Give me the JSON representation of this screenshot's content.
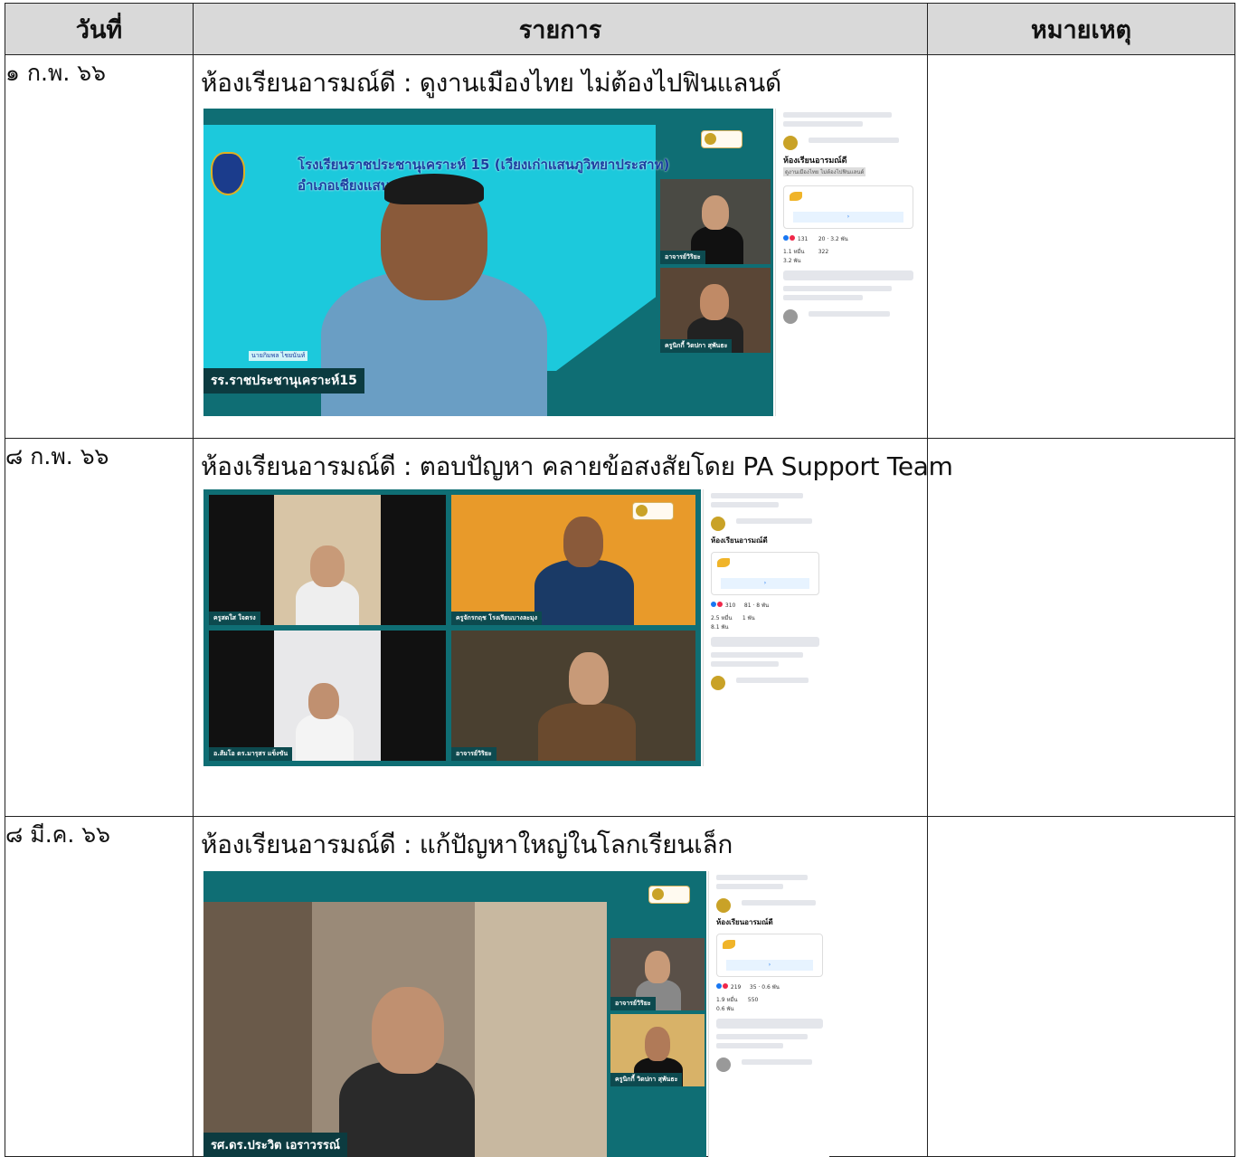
{
  "header": {
    "col_date": "วันที่",
    "col_item": "รายการ",
    "col_note": "หมายเหตุ"
  },
  "rows": [
    {
      "date": "๑ ก.พ. ๖๖",
      "title": "ห้องเรียนอารมณ์ดี : ดูงานเมืองไทย ไม่ต้องไปฟินแลนด์",
      "banner_line1": "โรงเรียนราชประชานุเคราะห์ 15 (เวียงเก่าแสนภูวิทยาประสาท)",
      "banner_line2": "อำเภอเชียงแสน จัง",
      "speaker_caption": "นายกิมพล ไชยนันท์",
      "main_label": "รร.ราชประชานุเคราะห์15",
      "tiles": [
        "อาจารย์วิริยะ",
        "ครูนิกกี้ วิดปกา สุพันธะ"
      ],
      "fb": {
        "page_title": "ห้องเรียนอารมณ์ดี",
        "subtitle": "ดูงานเมืองไทย ไม่ต้องไปฟินแลนด์",
        "reactions": "131",
        "comments": "20",
        "views": "3.2 พัน",
        "stat_a": "1.1 หมื่น",
        "stat_b": "322",
        "stat_c": "3.2 พัน"
      },
      "note": ""
    },
    {
      "date": "๘ ก.พ. ๖๖",
      "title": "ห้องเรียนอารมณ์ดี : ตอบปัญหา คลายข้อสงสัยโดย PA Support Team",
      "tiles": [
        "ครูสดใส ใจตรง",
        "ครูจักรกฤช โรงเรียนบางละมุง",
        "อ.ส้มโอ ดร.มารุสร แข็งขัน",
        "อาจารย์วิริยะ"
      ],
      "fb": {
        "page_title": "ห้องเรียนอารมณ์ดี",
        "reactions": "310",
        "comments": "81",
        "views": "8 พัน",
        "stat_a": "2.5 หมื่น",
        "stat_b": "1 พัน",
        "stat_c": "8.1 พัน"
      },
      "note": ""
    },
    {
      "date": "๘ มี.ค. ๖๖",
      "title": "ห้องเรียนอารมณ์ดี : แก้ปัญหาใหญ่ในโลกเรียนเล็ก",
      "main_label": "รศ.ดร.ประวิต เอราวรรณ์",
      "tiles": [
        "อาจารย์วิริยะ",
        "ครูนิกกี้ วิดปกา สุพันธะ"
      ],
      "fb": {
        "page_title": "ห้องเรียนอารมณ์ดี",
        "reactions": "219",
        "comments": "35",
        "views": "0.6 พัน",
        "stat_a": "1.9 หมื่น",
        "stat_b": "550",
        "stat_c": "0.6 พัน"
      },
      "note": ""
    }
  ],
  "colors": {
    "header_bg": "#d9d9d9",
    "stage_teal": "#0f6e74",
    "banner_cyan": "#1cc9dc",
    "facebook_blue": "#1877f2"
  }
}
